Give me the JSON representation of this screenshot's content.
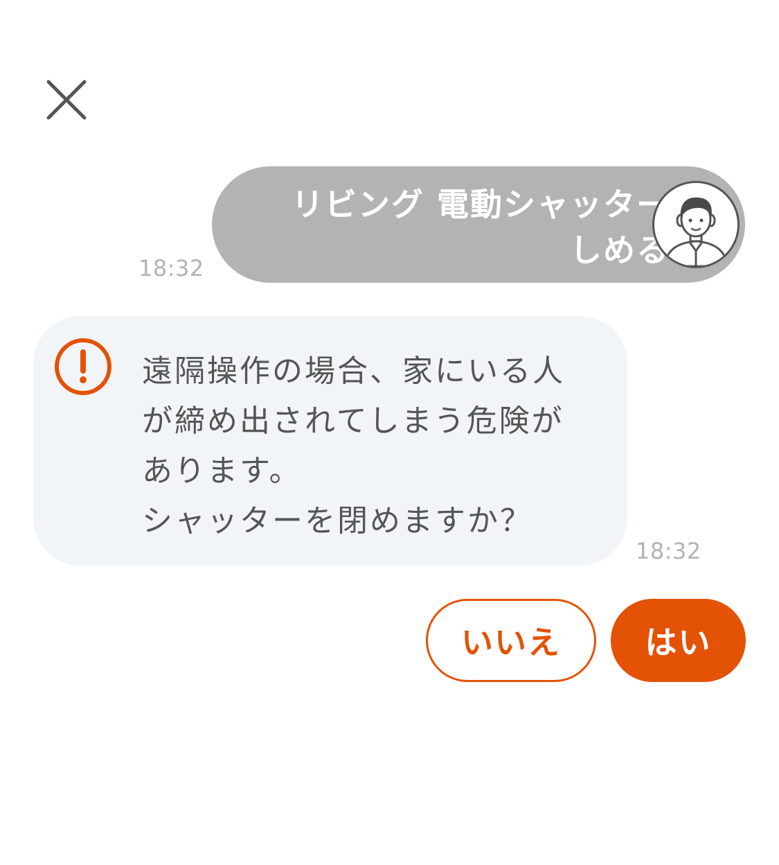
{
  "header": {
    "close_icon": "close-icon"
  },
  "user_message": {
    "lines": [
      "リビング 電動シャッター",
      "しめる"
    ],
    "time": "18:32",
    "avatar_icon": "user-avatar-icon",
    "bubble_color": "#b3b3b3"
  },
  "bot_message": {
    "icon": "alert-circle-icon",
    "lines": [
      "遠隔操作の場合、家にいる人",
      "が締め出されてしまう危険が",
      "あります。",
      "シャッターを閉めますか？"
    ],
    "time": "18:32",
    "bubble_color": "#f2f5f8"
  },
  "actions": {
    "no_label": "いいえ",
    "yes_label": "はい",
    "accent_color": "#e35205"
  }
}
